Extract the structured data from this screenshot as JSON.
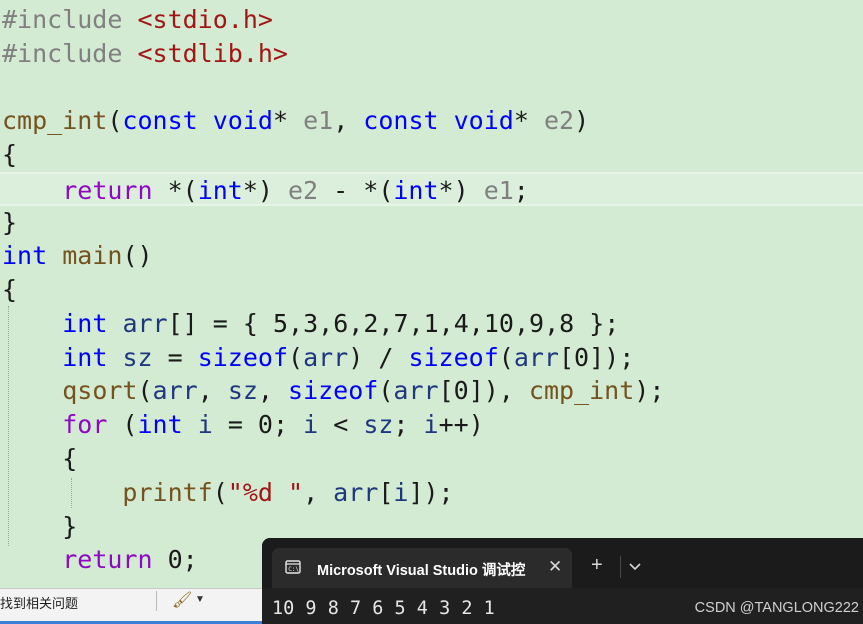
{
  "editor": {
    "lines": [
      [
        {
          "t": "#include ",
          "c": "pre"
        },
        {
          "t": "<stdio.h>",
          "c": "str"
        }
      ],
      [
        {
          "t": "#include ",
          "c": "pre"
        },
        {
          "t": "<stdlib.h>",
          "c": "str"
        }
      ],
      [],
      [
        {
          "t": "cmp_int",
          "c": "fn"
        },
        {
          "t": "(",
          "c": "plain"
        },
        {
          "t": "const",
          "c": "kw"
        },
        {
          "t": " ",
          "c": "plain"
        },
        {
          "t": "void",
          "c": "kw"
        },
        {
          "t": "* ",
          "c": "plain"
        },
        {
          "t": "e1",
          "c": "par"
        },
        {
          "t": ", ",
          "c": "plain"
        },
        {
          "t": "const",
          "c": "kw"
        },
        {
          "t": " ",
          "c": "plain"
        },
        {
          "t": "void",
          "c": "kw"
        },
        {
          "t": "* ",
          "c": "plain"
        },
        {
          "t": "e2",
          "c": "par"
        },
        {
          "t": ")",
          "c": "plain"
        }
      ],
      [
        {
          "t": "{",
          "c": "plain"
        }
      ],
      [
        {
          "t": "    ",
          "c": "plain"
        },
        {
          "t": "return",
          "c": "ctl"
        },
        {
          "t": " *(",
          "c": "plain"
        },
        {
          "t": "int",
          "c": "kw"
        },
        {
          "t": "*) ",
          "c": "plain"
        },
        {
          "t": "e2",
          "c": "par"
        },
        {
          "t": " - *(",
          "c": "plain"
        },
        {
          "t": "int",
          "c": "kw"
        },
        {
          "t": "*) ",
          "c": "plain"
        },
        {
          "t": "e1",
          "c": "par"
        },
        {
          "t": ";",
          "c": "plain"
        }
      ],
      [
        {
          "t": "}",
          "c": "plain"
        }
      ],
      [
        {
          "t": "int",
          "c": "kw"
        },
        {
          "t": " ",
          "c": "plain"
        },
        {
          "t": "main",
          "c": "fn"
        },
        {
          "t": "()",
          "c": "plain"
        }
      ],
      [
        {
          "t": "{",
          "c": "plain"
        }
      ],
      [
        {
          "t": "    ",
          "c": "plain"
        },
        {
          "t": "int",
          "c": "kw"
        },
        {
          "t": " ",
          "c": "plain"
        },
        {
          "t": "arr",
          "c": "var"
        },
        {
          "t": "[] = { ",
          "c": "plain"
        },
        {
          "t": "5",
          "c": "plain"
        },
        {
          "t": ",",
          "c": "plain"
        },
        {
          "t": "3",
          "c": "plain"
        },
        {
          "t": ",",
          "c": "plain"
        },
        {
          "t": "6",
          "c": "plain"
        },
        {
          "t": ",",
          "c": "plain"
        },
        {
          "t": "2",
          "c": "plain"
        },
        {
          "t": ",",
          "c": "plain"
        },
        {
          "t": "7",
          "c": "plain"
        },
        {
          "t": ",",
          "c": "plain"
        },
        {
          "t": "1",
          "c": "plain"
        },
        {
          "t": ",",
          "c": "plain"
        },
        {
          "t": "4",
          "c": "plain"
        },
        {
          "t": ",",
          "c": "plain"
        },
        {
          "t": "10",
          "c": "plain"
        },
        {
          "t": ",",
          "c": "plain"
        },
        {
          "t": "9",
          "c": "plain"
        },
        {
          "t": ",",
          "c": "plain"
        },
        {
          "t": "8",
          "c": "plain"
        },
        {
          "t": " };",
          "c": "plain"
        }
      ],
      [
        {
          "t": "    ",
          "c": "plain"
        },
        {
          "t": "int",
          "c": "kw"
        },
        {
          "t": " ",
          "c": "plain"
        },
        {
          "t": "sz",
          "c": "var"
        },
        {
          "t": " = ",
          "c": "plain"
        },
        {
          "t": "sizeof",
          "c": "kw"
        },
        {
          "t": "(",
          "c": "plain"
        },
        {
          "t": "arr",
          "c": "var"
        },
        {
          "t": ") / ",
          "c": "plain"
        },
        {
          "t": "sizeof",
          "c": "kw"
        },
        {
          "t": "(",
          "c": "plain"
        },
        {
          "t": "arr",
          "c": "var"
        },
        {
          "t": "[",
          "c": "plain"
        },
        {
          "t": "0",
          "c": "plain"
        },
        {
          "t": "]);",
          "c": "plain"
        }
      ],
      [
        {
          "t": "    ",
          "c": "plain"
        },
        {
          "t": "qsort",
          "c": "fn"
        },
        {
          "t": "(",
          "c": "plain"
        },
        {
          "t": "arr",
          "c": "var"
        },
        {
          "t": ", ",
          "c": "plain"
        },
        {
          "t": "sz",
          "c": "var"
        },
        {
          "t": ", ",
          "c": "plain"
        },
        {
          "t": "sizeof",
          "c": "kw"
        },
        {
          "t": "(",
          "c": "plain"
        },
        {
          "t": "arr",
          "c": "var"
        },
        {
          "t": "[",
          "c": "plain"
        },
        {
          "t": "0",
          "c": "plain"
        },
        {
          "t": "]), ",
          "c": "plain"
        },
        {
          "t": "cmp_int",
          "c": "fn"
        },
        {
          "t": ");",
          "c": "plain"
        }
      ],
      [
        {
          "t": "    ",
          "c": "plain"
        },
        {
          "t": "for",
          "c": "ctl"
        },
        {
          "t": " (",
          "c": "plain"
        },
        {
          "t": "int",
          "c": "kw"
        },
        {
          "t": " ",
          "c": "plain"
        },
        {
          "t": "i",
          "c": "var"
        },
        {
          "t": " = ",
          "c": "plain"
        },
        {
          "t": "0",
          "c": "plain"
        },
        {
          "t": "; ",
          "c": "plain"
        },
        {
          "t": "i",
          "c": "var"
        },
        {
          "t": " < ",
          "c": "plain"
        },
        {
          "t": "sz",
          "c": "var"
        },
        {
          "t": "; ",
          "c": "plain"
        },
        {
          "t": "i",
          "c": "var"
        },
        {
          "t": "++)",
          "c": "plain"
        }
      ],
      [
        {
          "t": "    {",
          "c": "plain"
        }
      ],
      [
        {
          "t": "        ",
          "c": "plain"
        },
        {
          "t": "printf",
          "c": "fn"
        },
        {
          "t": "(",
          "c": "plain"
        },
        {
          "t": "\"%d \"",
          "c": "str"
        },
        {
          "t": ", ",
          "c": "plain"
        },
        {
          "t": "arr",
          "c": "var"
        },
        {
          "t": "[",
          "c": "plain"
        },
        {
          "t": "i",
          "c": "var"
        },
        {
          "t": "]);",
          "c": "plain"
        }
      ],
      [
        {
          "t": "    }",
          "c": "plain"
        }
      ],
      [
        {
          "t": "    ",
          "c": "plain"
        },
        {
          "t": "return",
          "c": "ctl"
        },
        {
          "t": " ",
          "c": "plain"
        },
        {
          "t": "0",
          "c": "plain"
        },
        {
          "t": ";",
          "c": "plain"
        }
      ]
    ]
  },
  "status_bar": {
    "issues_text": "找到相关问题",
    "brush_icon": "brush-icon",
    "dropdown_icon": "caret-down-icon"
  },
  "terminal": {
    "tab_title": "Microsoft Visual Studio 调试控",
    "tab_icon": "console-icon",
    "close_icon": "close-icon",
    "add_icon": "plus-icon",
    "dropdown_icon": "chevron-down-icon",
    "output": "10 9 8 7 6 5 4 3 2 1",
    "background": "#202020"
  },
  "watermark": "CSDN @TANGLONG222",
  "colors": {
    "editor_background": "#d3ead3",
    "keyword": "#0000ff",
    "control": "#8f08c4",
    "function": "#74531f",
    "string": "#a31515",
    "variable": "#1f377f"
  }
}
